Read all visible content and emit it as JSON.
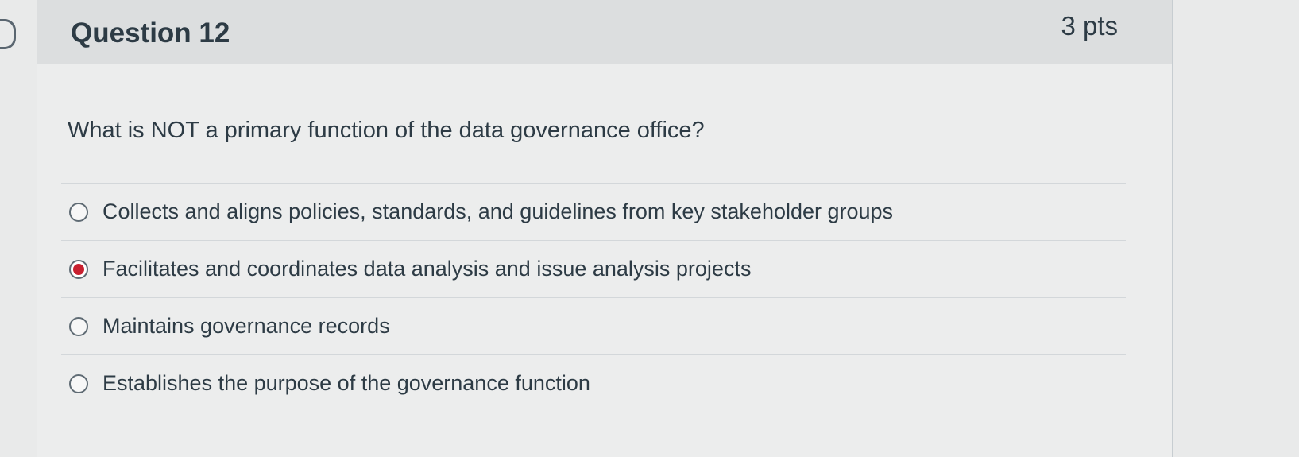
{
  "question": {
    "title": "Question 12",
    "points": "3 pts",
    "text": "What is NOT a primary function of the data governance office?"
  },
  "answers": [
    {
      "label": "Collects and aligns policies, standards, and guidelines from key stakeholder groups",
      "selected": false
    },
    {
      "label": "Facilitates and coordinates data analysis and issue analysis projects",
      "selected": true
    },
    {
      "label": "Maintains governance records",
      "selected": false
    },
    {
      "label": "Establishes the purpose of the governance function",
      "selected": false
    }
  ],
  "colors": {
    "selected_radio": "#c8202f",
    "text": "#2d3b45",
    "header_bg": "#dcdedf"
  },
  "icons": {
    "bookmark": "bookmark-flag-icon"
  }
}
